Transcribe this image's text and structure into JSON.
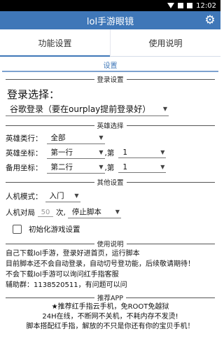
{
  "status": {
    "time": "12:02"
  },
  "app": {
    "title": "lol手游眼镜"
  },
  "tabs": [
    {
      "label": "功能设置"
    },
    {
      "label": "使用说明"
    }
  ],
  "subtab": {
    "label": "设置"
  },
  "sections": {
    "login": "登录设置",
    "hero": "英雄选择",
    "other": "其他设置",
    "usage": "使用说明",
    "recommend": "推荐APP"
  },
  "login": {
    "label": "登录选择：",
    "value": "谷歌登录（要在ourplay提前登录好）"
  },
  "hero": {
    "category_label": "英雄类行：",
    "category_value": "全部",
    "coord_label": "英雄坐标：",
    "coord_row": "第一行",
    "coord_sep": ",第",
    "coord_col": "1",
    "backup_label": "备用坐标：",
    "backup_row": "第二行",
    "backup_sep": ",第",
    "backup_col": "1"
  },
  "other": {
    "mode_label": "人机模式：",
    "mode_value": "入门",
    "times_label": "人机对局",
    "times_value": "50",
    "times_unit": "次,",
    "stop_value": "停止脚本",
    "init_label": "初始化游戏设置"
  },
  "usage_lines": [
    "自己下载lol手游，登录好进首页，运行脚本",
    "目前脚本还不会自动登录，自动切号登功能，后续敬请期待！",
    "不会下载lol手游可以询问红手指客服",
    "辅助群：1138520511，有问题可以问"
  ],
  "recommend_lines": [
    "★推荐红手指云手机，免ROOT免越狱",
    "24H在线，不断网不关机，不耗内存不发烫!",
    "脚本搭配红手指，解放的不只是你还有你的宝贝手机！"
  ],
  "colors": {
    "accent": "#3f77b8"
  },
  "icons": {
    "settings": "gear-icon"
  }
}
